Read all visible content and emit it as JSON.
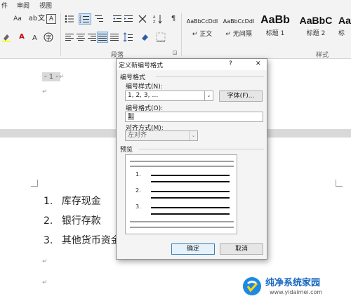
{
  "menubar": {
    "items": [
      "件",
      "审阅",
      "视图"
    ]
  },
  "ribbon": {
    "font_group": {
      "aa_label": "Aa",
      "wen_label": "文",
      "a_label": "A"
    },
    "paragraph_group_label": "段落",
    "styles_group_label": "样式",
    "styles": [
      {
        "sample": "AaBbCcDdI",
        "name": "↵ 正文"
      },
      {
        "sample": "AaBbCcDdI",
        "name": "↵ 无间隔"
      },
      {
        "sample": "AaBb",
        "name": "标题 1"
      },
      {
        "sample": "AaBbC",
        "name": "标题 2"
      },
      {
        "sample": "AaB",
        "name": "标"
      }
    ]
  },
  "document": {
    "header_page_number": "- 1 -",
    "list": [
      {
        "num": "1.",
        "text": "库存现金"
      },
      {
        "num": "2.",
        "text": "银行存款"
      },
      {
        "num": "3.",
        "text": "其他货币资金"
      }
    ],
    "para_mark": "↵"
  },
  "dialog": {
    "title": "定义新编号格式",
    "help": "?",
    "close": "✕",
    "section_number_format": "编号格式",
    "number_style_label": "编号样式(N):",
    "number_style_value": "1, 2, 3, …",
    "font_button": "字体(F)...",
    "number_format_label": "编号格式(O):",
    "number_format_value": "1.",
    "alignment_label": "对齐方式(M):",
    "alignment_value": "左对齐",
    "preview_label": "预览",
    "preview_numbers": [
      "1.",
      "2.",
      "3."
    ],
    "ok_button": "确定",
    "cancel_button": "取消"
  },
  "watermark": {
    "title": "纯净系统家园",
    "url": "www.yidaimei.com"
  }
}
